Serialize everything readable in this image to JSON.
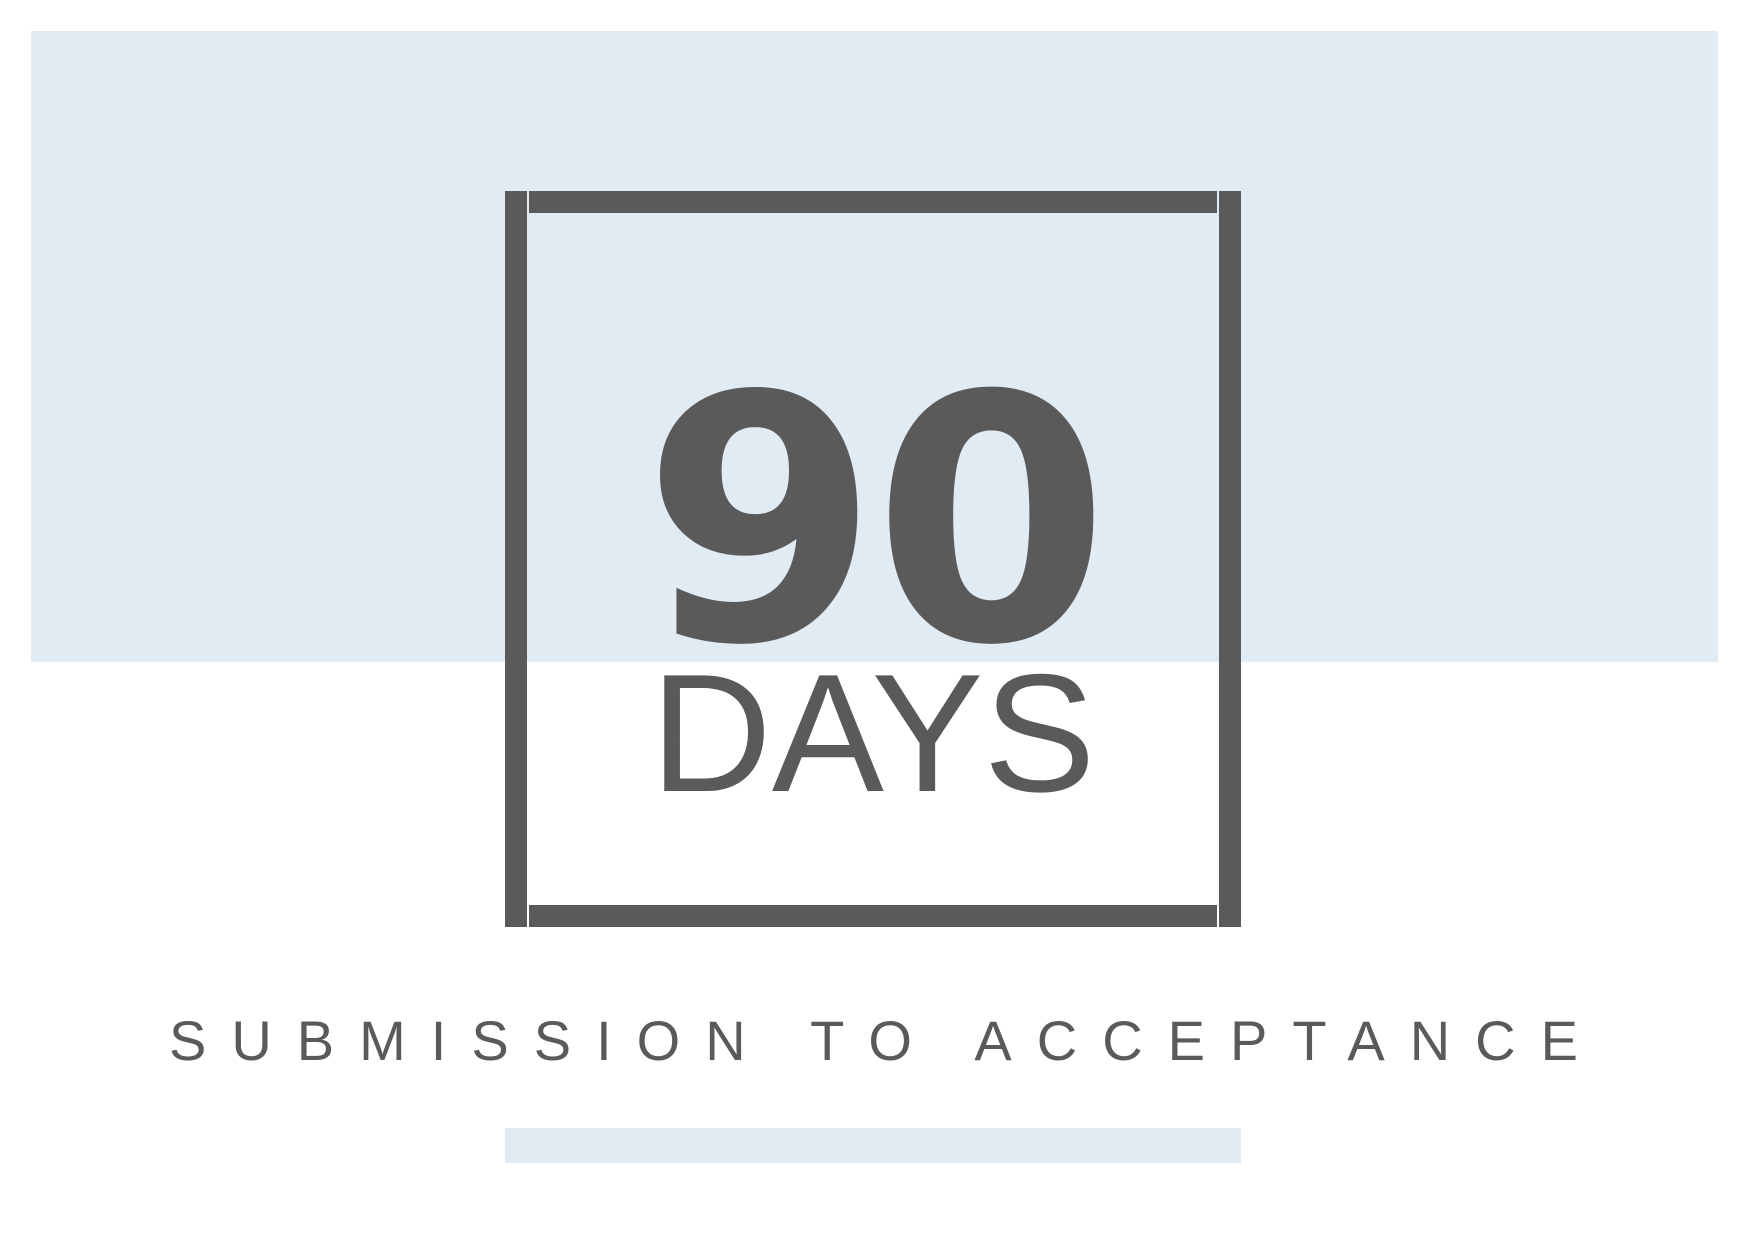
{
  "stat": {
    "value": "90",
    "unit": "DAYS",
    "caption": "SUBMISSION TO ACCEPTANCE"
  },
  "colors": {
    "band": "#e1ebf4",
    "text": "#5a5a5a",
    "background": "#ffffff"
  }
}
